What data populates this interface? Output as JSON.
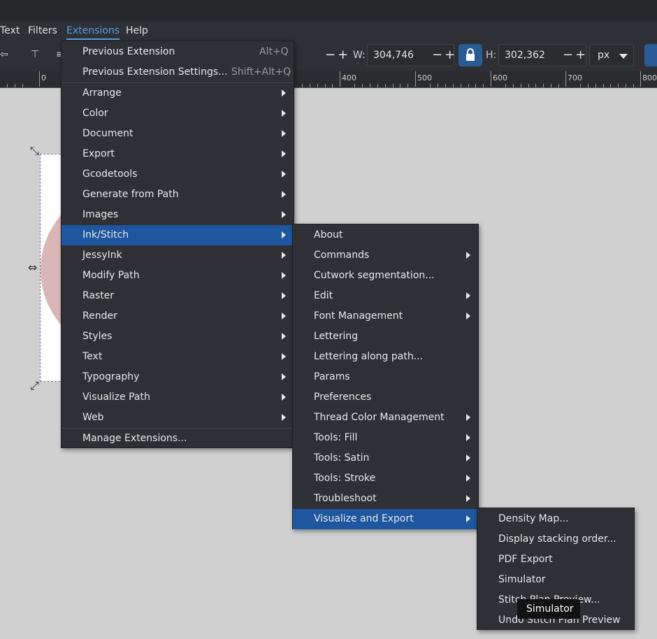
{
  "menubar": [
    {
      "label": "Text",
      "active": false
    },
    {
      "label": "Filters",
      "active": false
    },
    {
      "label": "Extensions",
      "active": true
    },
    {
      "label": "Help",
      "active": false
    }
  ],
  "toolbar": {
    "w_label": "W:",
    "w_value": "304,746",
    "h_label": "H:",
    "h_value": "302,362",
    "unit": "px",
    "pm": "−+"
  },
  "ruler": {
    "labels": [
      "0",
      "400",
      "500",
      "600",
      "700",
      "800"
    ]
  },
  "extensions_menu": {
    "items": [
      {
        "label": "Previous Extension",
        "shortcut": "Alt+Q",
        "submenu": false
      },
      {
        "label": "Previous Extension Settings...",
        "shortcut": "Shift+Alt+Q",
        "submenu": false
      },
      {
        "label": "Arrange",
        "submenu": true
      },
      {
        "label": "Color",
        "submenu": true
      },
      {
        "label": "Document",
        "submenu": true
      },
      {
        "label": "Export",
        "submenu": true
      },
      {
        "label": "Gcodetools",
        "submenu": true
      },
      {
        "label": "Generate from Path",
        "submenu": true
      },
      {
        "label": "Images",
        "submenu": true
      },
      {
        "label": "Ink/Stitch",
        "submenu": true,
        "highlighted": true
      },
      {
        "label": "JessyInk",
        "submenu": true
      },
      {
        "label": "Modify Path",
        "submenu": true
      },
      {
        "label": "Raster",
        "submenu": true
      },
      {
        "label": "Render",
        "submenu": true
      },
      {
        "label": "Styles",
        "submenu": true
      },
      {
        "label": "Text",
        "submenu": true
      },
      {
        "label": "Typography",
        "submenu": true
      },
      {
        "label": "Visualize Path",
        "submenu": true
      },
      {
        "label": "Web",
        "submenu": true
      },
      {
        "label": "Manage Extensions...",
        "submenu": false
      }
    ]
  },
  "inkstitch_menu": {
    "items": [
      {
        "label": "About",
        "submenu": false
      },
      {
        "label": "Commands",
        "submenu": true
      },
      {
        "label": "Cutwork segmentation...",
        "submenu": false
      },
      {
        "label": "Edit",
        "submenu": true
      },
      {
        "label": "Font Management",
        "submenu": true
      },
      {
        "label": "Lettering",
        "submenu": false
      },
      {
        "label": "Lettering along path...",
        "submenu": false
      },
      {
        "label": "Params",
        "submenu": false
      },
      {
        "label": "Preferences",
        "submenu": false
      },
      {
        "label": "Thread Color Management",
        "submenu": true
      },
      {
        "label": "Tools: Fill",
        "submenu": true
      },
      {
        "label": "Tools: Satin",
        "submenu": true
      },
      {
        "label": "Tools: Stroke",
        "submenu": true
      },
      {
        "label": "Troubleshoot",
        "submenu": true
      },
      {
        "label": "Visualize and Export",
        "submenu": true,
        "highlighted": true
      }
    ]
  },
  "visualize_menu": {
    "items": [
      {
        "label": "Density Map..."
      },
      {
        "label": "Display stacking order..."
      },
      {
        "label": "PDF Export"
      },
      {
        "label": "Simulator"
      },
      {
        "label": "Stitch Plan Preview..."
      },
      {
        "label": "Undo Stitch Plan Preview"
      }
    ]
  },
  "tooltip": {
    "text": "Simulator"
  },
  "colors": {
    "menu_bg": "#2e3035",
    "highlight": "#1e56a0",
    "accent": "#5a9ee6",
    "canvas": "#d0d0d0"
  }
}
